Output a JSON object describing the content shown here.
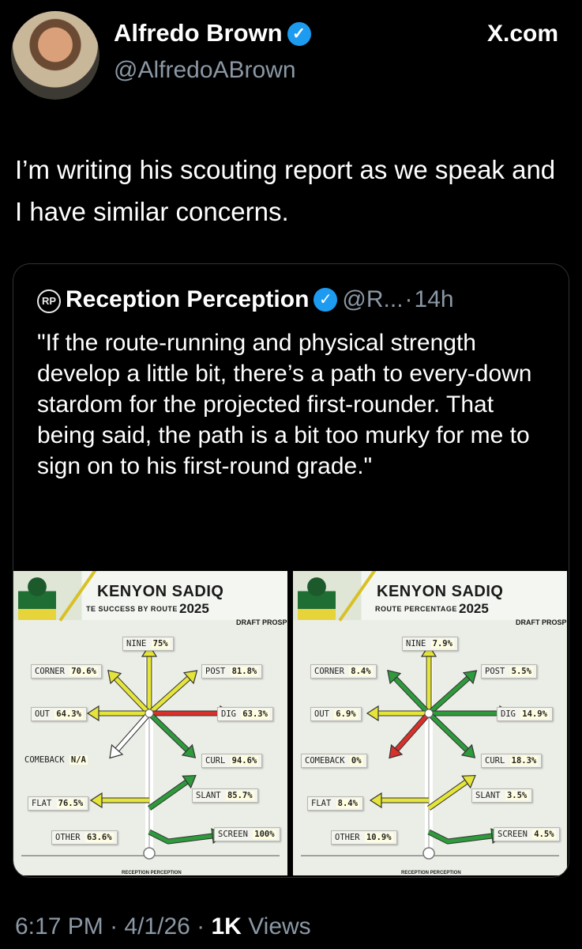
{
  "author": {
    "name": "Alfredo Brown",
    "handle": "@AlfredoABrown"
  },
  "site": "X.com",
  "tweet_text": "I’m writing his scouting report as we speak and I have similar concerns.",
  "quoted": {
    "name": "Reception Perception",
    "logo": "RP",
    "handle": "@R...",
    "age": "14h",
    "text": "\"If the route-running and physical strength develop a little bit, there’s a path to every-down stardom for the projected first-rounder. That being said, the path is a bit too murky for me to sign on to his first-round grade.\""
  },
  "cards": [
    {
      "title": "KENYON SADIQ",
      "subtitle": "TE SUCCESS BY ROUTE",
      "year": "2025",
      "draft": "DRAFT PROSPEC",
      "routes": {
        "nine": {
          "label": "NINE",
          "value": "75%",
          "color": "#e4e43a"
        },
        "corner": {
          "label": "CORNER",
          "value": "70.6%",
          "color": "#e4e43a"
        },
        "post": {
          "label": "POST",
          "value": "81.8%",
          "color": "#e4e43a"
        },
        "out": {
          "label": "OUT",
          "value": "64.3%",
          "color": "#e4e43a"
        },
        "dig": {
          "label": "DIG",
          "value": "63.3%",
          "color": "#d8302a"
        },
        "comeback": {
          "label": "COMEBACK",
          "value": "N/A",
          "color": "#ffffff"
        },
        "curl": {
          "label": "CURL",
          "value": "94.6%",
          "color": "#2e9a3c"
        },
        "slant": {
          "label": "SLANT",
          "value": "85.7%",
          "color": "#2e9a3c"
        },
        "flat": {
          "label": "FLAT",
          "value": "76.5%",
          "color": "#e4e43a"
        },
        "screen": {
          "label": "SCREEN",
          "value": "100%",
          "color": "#2e9a3c"
        },
        "other": {
          "label": "OTHER",
          "value": "63.6%",
          "color": null
        }
      },
      "footer_mark": "RECEPTION PERCEPTION"
    },
    {
      "title": "KENYON SADIQ",
      "subtitle": "ROUTE PERCENTAGE",
      "year": "2025",
      "draft": "DRAFT PROSPEC",
      "routes": {
        "nine": {
          "label": "NINE",
          "value": "7.9%",
          "color": "#e4e43a"
        },
        "corner": {
          "label": "CORNER",
          "value": "8.4%",
          "color": "#2e9a3c"
        },
        "post": {
          "label": "POST",
          "value": "5.5%",
          "color": "#2e9a3c"
        },
        "out": {
          "label": "OUT",
          "value": "6.9%",
          "color": "#e4e43a"
        },
        "dig": {
          "label": "DIG",
          "value": "14.9%",
          "color": "#2e9a3c"
        },
        "comeback": {
          "label": "COMEBACK",
          "value": "0%",
          "color": "#d8302a"
        },
        "curl": {
          "label": "CURL",
          "value": "18.3%",
          "color": "#2e9a3c"
        },
        "slant": {
          "label": "SLANT",
          "value": "3.5%",
          "color": "#e4e43a"
        },
        "flat": {
          "label": "FLAT",
          "value": "8.4%",
          "color": "#e4e43a"
        },
        "screen": {
          "label": "SCREEN",
          "value": "4.5%",
          "color": "#2e9a3c"
        },
        "other": {
          "label": "OTHER",
          "value": "10.9%",
          "color": null
        }
      },
      "footer_mark": "RECEPTION PERCEPTION"
    }
  ],
  "timestamp": {
    "time": "6:17 PM",
    "date": "4/1/26",
    "views_count": "1K",
    "views_label": "Views"
  }
}
